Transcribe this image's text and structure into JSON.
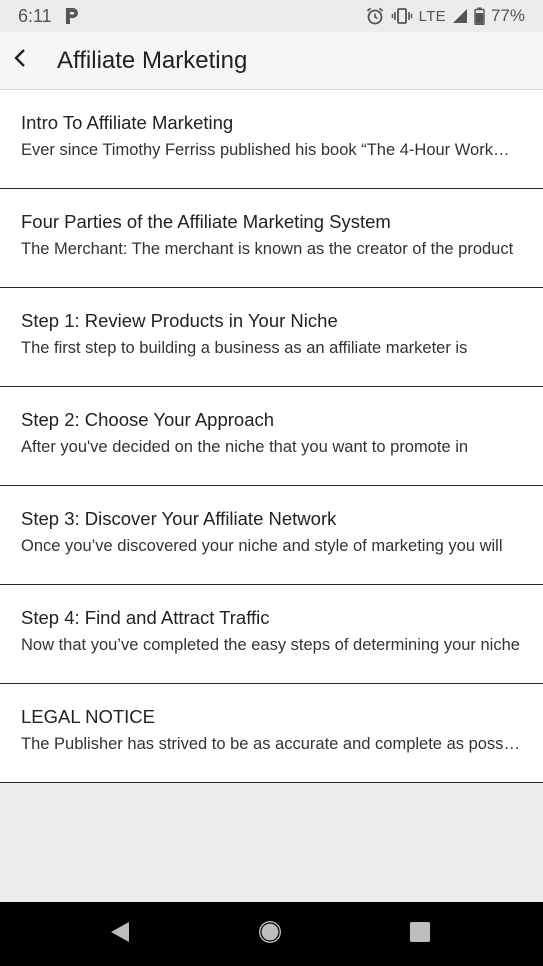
{
  "status_bar": {
    "time": "6:11",
    "network": "LTE",
    "battery_percent": "77%",
    "icons": [
      "p-icon",
      "alarm-icon",
      "vibrate-icon",
      "signal-icon",
      "battery-icon"
    ]
  },
  "app_bar": {
    "title": "Affiliate Marketing",
    "back_icon": "chevron-left-icon"
  },
  "items": [
    {
      "title": "Intro To Affiliate Marketing",
      "subtitle": "Ever since Timothy Ferriss published his book “The 4-Hour Workweek”"
    },
    {
      "title": "Four Parties of the Affiliate Marketing System",
      "subtitle": "The Merchant: The merchant is known as the creator of the product"
    },
    {
      "title": "Step 1: Review Products in Your Niche",
      "subtitle": "The first step to building a business as an affiliate marketer is"
    },
    {
      "title": "Step 2: Choose Your Approach",
      "subtitle": "After you've decided on the niche that you want to promote in"
    },
    {
      "title": "Step 3: Discover Your Affiliate Network",
      "subtitle": "Once you’ve discovered your niche and style of marketing you will"
    },
    {
      "title": "Step 4: Find and Attract Traffic",
      "subtitle": "Now that you’ve completed the easy steps of determining your niche"
    },
    {
      "title": "LEGAL NOTICE",
      "subtitle": "The Publisher has strived to be as accurate and complete as possible"
    }
  ],
  "nav_bar": {
    "icons": [
      "nav-back-icon",
      "nav-home-icon",
      "nav-recents-icon"
    ]
  }
}
